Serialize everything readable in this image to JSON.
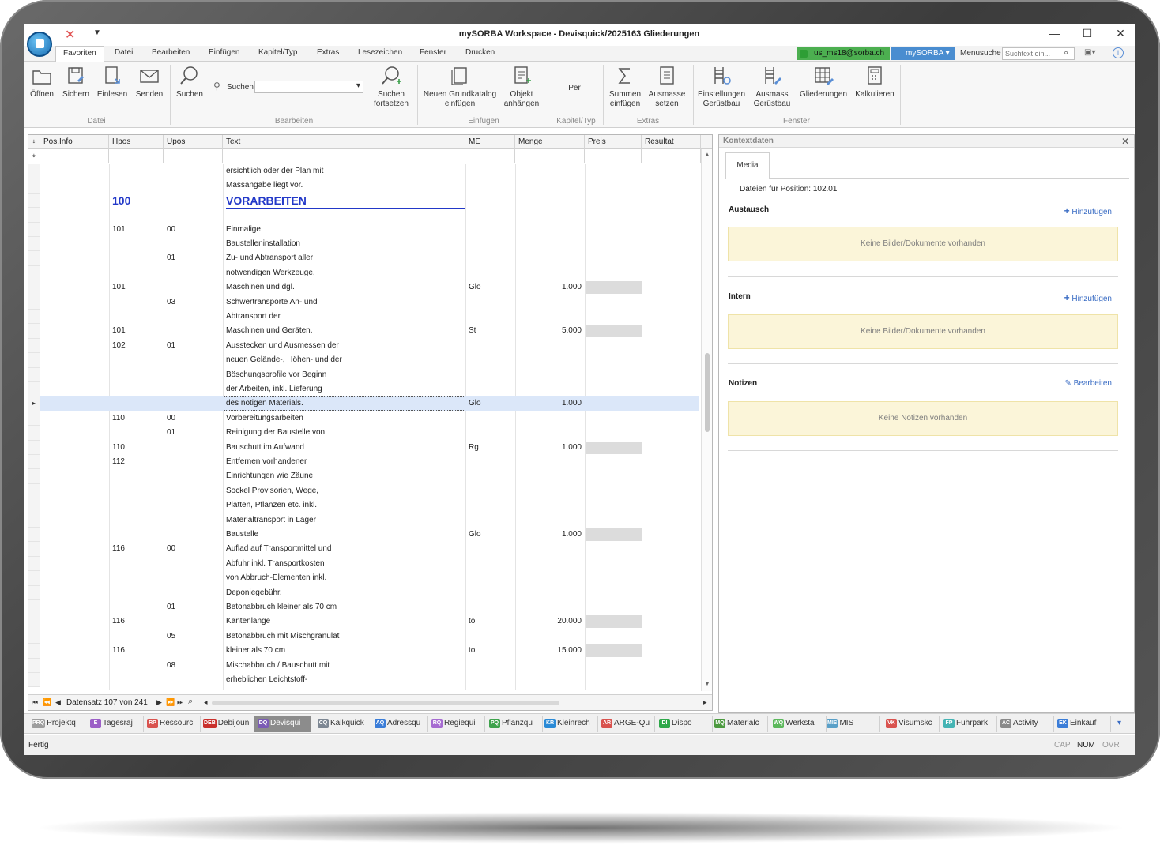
{
  "window": {
    "title": "mySORBA Workspace - Devisquick/2025163 Gliederungen"
  },
  "ribbon_tabs": [
    "Favoriten",
    "Datei",
    "Bearbeiten",
    "Einfügen",
    "Kapitel/Typ",
    "Extras",
    "Lesezeichen",
    "Fenster",
    "Drucken"
  ],
  "active_tab": "Favoriten",
  "user": {
    "email": "us_ms18@sorba.ch",
    "mysorba_label": "mySORBA ▾",
    "menusuche_label": "Menusuche",
    "menusuche_placeholder": "Suchtext ein..."
  },
  "ribbon": {
    "buttons": {
      "oeffnen": "Öffnen",
      "sichern": "Sichern",
      "einlesen": "Einlesen",
      "senden": "Senden",
      "suchen": "Suchen",
      "suchen_field_label": "Suchen",
      "suchen_fortsetzen_1": "Suchen",
      "suchen_fortsetzen_2": "fortsetzen",
      "grundkatalog_1": "Neuen Grundkatalog",
      "grundkatalog_2": "einfügen",
      "objekt_1": "Objekt",
      "objekt_2": "anhängen",
      "per": "Per",
      "summen_1": "Summen",
      "summen_2": "einfügen",
      "ausmasse_1": "Ausmasse",
      "ausmasse_2": "setzen",
      "einst_1": "Einstellungen",
      "einst_2": "Gerüstbau",
      "ausmass_ger_1": "Ausmass",
      "ausmass_ger_2": "Gerüstbau",
      "gliederungen": "Gliederungen",
      "kalkulieren": "Kalkulieren"
    },
    "groups": {
      "datei": "Datei",
      "bearbeiten": "Bearbeiten",
      "einfuegen": "Einfügen",
      "kapitel": "Kapitel/Typ",
      "extras": "Extras",
      "fenster": "Fenster"
    }
  },
  "grid": {
    "columns": {
      "posinfo": "Pos.Info",
      "hpos": "Hpos",
      "upos": "Upos",
      "text": "Text",
      "me": "ME",
      "menge": "Menge",
      "preis": "Preis",
      "resultat": "Resultat"
    },
    "rows": [
      {
        "hpos": "",
        "upos": "",
        "text": "ersichtlich oder der Plan mit",
        "me": "",
        "menge": "",
        "preis": false
      },
      {
        "hpos": "",
        "upos": "",
        "text": "Massangabe liegt vor.",
        "me": "",
        "menge": "",
        "preis": false
      },
      {
        "hpos": "100",
        "upos": "",
        "text": "VORARBEITEN",
        "me": "",
        "menge": "",
        "preis": false,
        "heading": true
      },
      {
        "hpos": "",
        "upos": "",
        "text": "",
        "me": "",
        "menge": "",
        "preis": false
      },
      {
        "hpos": "101",
        "upos": "00",
        "text": "Einmalige",
        "me": "",
        "menge": "",
        "preis": false
      },
      {
        "hpos": "",
        "upos": "",
        "text": "Baustelleninstallation",
        "me": "",
        "menge": "",
        "preis": false
      },
      {
        "hpos": "",
        "upos": "01",
        "text": "Zu- und Abtransport aller",
        "me": "",
        "menge": "",
        "preis": false
      },
      {
        "hpos": "",
        "upos": "",
        "text": "notwendigen Werkzeuge,",
        "me": "",
        "menge": "",
        "preis": false
      },
      {
        "hpos": "101",
        "upos": "",
        "text": "Maschinen und dgl.",
        "me": "Glo",
        "menge": "1.000",
        "preis": true
      },
      {
        "hpos": "",
        "upos": "03",
        "text": "Schwertransporte An- und",
        "me": "",
        "menge": "",
        "preis": false
      },
      {
        "hpos": "",
        "upos": "",
        "text": "Abtransport der",
        "me": "",
        "menge": "",
        "preis": false
      },
      {
        "hpos": "101",
        "upos": "",
        "text": "Maschinen und Geräten.",
        "me": "St",
        "menge": "5.000",
        "preis": true
      },
      {
        "hpos": "102",
        "upos": "01",
        "text": "Ausstecken und Ausmessen der",
        "me": "",
        "menge": "",
        "preis": false
      },
      {
        "hpos": "",
        "upos": "",
        "text": "neuen Gelände-, Höhen- und der",
        "me": "",
        "menge": "",
        "preis": false
      },
      {
        "hpos": "",
        "upos": "",
        "text": "Böschungsprofile vor Beginn",
        "me": "",
        "menge": "",
        "preis": false
      },
      {
        "hpos": "",
        "upos": "",
        "text": "der Arbeiten, inkl. Lieferung",
        "me": "",
        "menge": "",
        "preis": false
      },
      {
        "hpos": "",
        "upos": "",
        "text": "des nötigen Materials.",
        "me": "Glo",
        "menge": "1.000",
        "preis": false,
        "selected": true
      },
      {
        "hpos": "110",
        "upos": "00",
        "text": "Vorbereitungsarbeiten",
        "me": "",
        "menge": "",
        "preis": false
      },
      {
        "hpos": "",
        "upos": "01",
        "text": "Reinigung der Baustelle von",
        "me": "",
        "menge": "",
        "preis": false
      },
      {
        "hpos": "110",
        "upos": "",
        "text": "Bauschutt im Aufwand",
        "me": "Rg",
        "menge": "1.000",
        "preis": true
      },
      {
        "hpos": "112",
        "upos": "",
        "text": "Entfernen vorhandener",
        "me": "",
        "menge": "",
        "preis": false
      },
      {
        "hpos": "",
        "upos": "",
        "text": "Einrichtungen wie Zäune,",
        "me": "",
        "menge": "",
        "preis": false
      },
      {
        "hpos": "",
        "upos": "",
        "text": "Sockel Provisorien, Wege,",
        "me": "",
        "menge": "",
        "preis": false
      },
      {
        "hpos": "",
        "upos": "",
        "text": "Platten, Pflanzen etc. inkl.",
        "me": "",
        "menge": "",
        "preis": false
      },
      {
        "hpos": "",
        "upos": "",
        "text": "Materialtransport in Lager",
        "me": "",
        "menge": "",
        "preis": false
      },
      {
        "hpos": "",
        "upos": "",
        "text": "Baustelle",
        "me": "Glo",
        "menge": "1.000",
        "preis": true
      },
      {
        "hpos": "116",
        "upos": "00",
        "text": "Auflad auf Transportmittel und",
        "me": "",
        "menge": "",
        "preis": false
      },
      {
        "hpos": "",
        "upos": "",
        "text": "Abfuhr inkl. Transportkosten",
        "me": "",
        "menge": "",
        "preis": false
      },
      {
        "hpos": "",
        "upos": "",
        "text": "von Abbruch-Elementen inkl.",
        "me": "",
        "menge": "",
        "preis": false
      },
      {
        "hpos": "",
        "upos": "",
        "text": "Deponiegebühr.",
        "me": "",
        "menge": "",
        "preis": false
      },
      {
        "hpos": "",
        "upos": "01",
        "text": "Betonabbruch kleiner als 70 cm",
        "me": "",
        "menge": "",
        "preis": false
      },
      {
        "hpos": "116",
        "upos": "",
        "text": "Kantenlänge",
        "me": "to",
        "menge": "20.000",
        "preis": true
      },
      {
        "hpos": "",
        "upos": "05",
        "text": "Betonabbruch mit Mischgranulat",
        "me": "",
        "menge": "",
        "preis": false
      },
      {
        "hpos": "116",
        "upos": "",
        "text": "kleiner als 70 cm",
        "me": "to",
        "menge": "15.000",
        "preis": true
      },
      {
        "hpos": "",
        "upos": "08",
        "text": "Mischabbruch / Bauschutt mit",
        "me": "",
        "menge": "",
        "preis": false
      },
      {
        "hpos": "",
        "upos": "",
        "text": "erheblichen Leichtstoff-",
        "me": "",
        "menge": "",
        "preis": false
      }
    ],
    "record_info": "Datensatz 107 von 241"
  },
  "context": {
    "title": "Kontextdaten",
    "tab": "Media",
    "dateien": "Dateien für Position: 102.01",
    "sections": {
      "austausch": "Austausch",
      "intern": "Intern",
      "notizen": "Notizen"
    },
    "hinzufuegen": "Hinzufügen",
    "bearbeiten": "Bearbeiten",
    "empty_docs": "Keine Bilder/Dokumente vorhanden",
    "empty_notes": "Keine Notizen vorhanden"
  },
  "modules": [
    {
      "badge": "PRQ",
      "label": "Projektq",
      "color": "#9e9e9e"
    },
    {
      "badge": "E",
      "label": "Tagesraj",
      "color": "#9c5fc7"
    },
    {
      "badge": "RP",
      "label": "Ressourc",
      "color": "#d9534f"
    },
    {
      "badge": "DEB",
      "label": "Debijoun",
      "color": "#c9302c"
    },
    {
      "badge": "DQ",
      "label": "Devisqui",
      "color": "#7b5bb5",
      "active": true
    },
    {
      "badge": "CQ",
      "label": "Kalkquick",
      "color": "#7d8793"
    },
    {
      "badge": "AQ",
      "label": "Adressqu",
      "color": "#3b7dd8"
    },
    {
      "badge": "RQ",
      "label": "Regiequi",
      "color": "#a66bd1"
    },
    {
      "badge": "PQ",
      "label": "Pflanzqu",
      "color": "#3fa34d"
    },
    {
      "badge": "KR",
      "label": "Kleinrech",
      "color": "#2a8ad6"
    },
    {
      "badge": "AR",
      "label": "ARGE-Qu",
      "color": "#d9534f"
    },
    {
      "badge": "DI",
      "label": "Dispo",
      "color": "#2ea84a"
    },
    {
      "badge": "MQ",
      "label": "Materialc",
      "color": "#4c9a3f"
    },
    {
      "badge": "WQ",
      "label": "Werksta",
      "color": "#5cb85c"
    },
    {
      "badge": "MIS",
      "label": "MIS",
      "color": "#5aa0c8"
    },
    {
      "badge": "VK",
      "label": "Visumskc",
      "color": "#d9534f"
    },
    {
      "badge": "FP",
      "label": "Fuhrpark",
      "color": "#45b4b4"
    },
    {
      "badge": "AC",
      "label": "Activity",
      "color": "#8a8a8a"
    },
    {
      "badge": "EK",
      "label": "Einkauf",
      "color": "#3b7dd8"
    }
  ],
  "status": {
    "left": "Fertig",
    "cap": "CAP",
    "num": "NUM",
    "ovr": "OVR"
  }
}
